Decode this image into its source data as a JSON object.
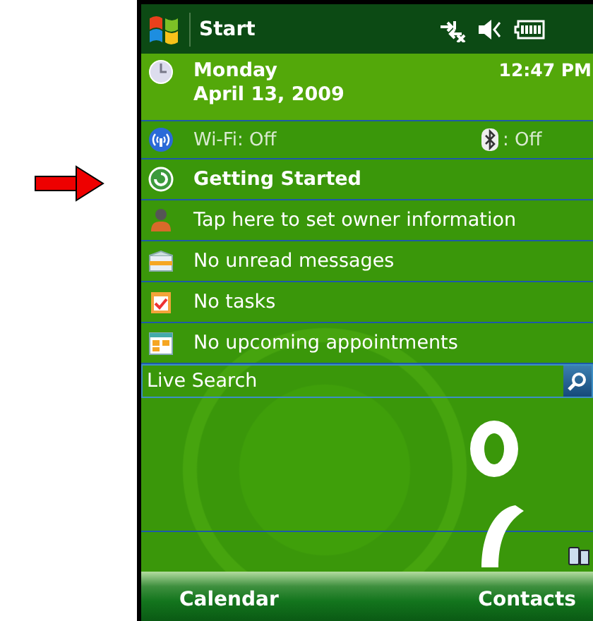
{
  "title_bar": {
    "title": "Start"
  },
  "date_row": {
    "day": "Monday",
    "date": "April 13, 2009",
    "time": "12:47 PM"
  },
  "wireless_row": {
    "wifi": "Wi-Fi: Off",
    "bluetooth": ": Off"
  },
  "items": [
    {
      "kind": "getting-started",
      "label": "Getting Started",
      "selected": true
    },
    {
      "kind": "owner",
      "label": "Tap here to set owner information",
      "selected": false
    },
    {
      "kind": "messages",
      "label": "No unread messages",
      "selected": false
    },
    {
      "kind": "tasks",
      "label": "No tasks",
      "selected": false
    },
    {
      "kind": "calendar",
      "label": "No upcoming appointments",
      "selected": false
    }
  ],
  "search": {
    "placeholder": "Live Search"
  },
  "softkeys": [
    "Calendar",
    "Contacts"
  ]
}
